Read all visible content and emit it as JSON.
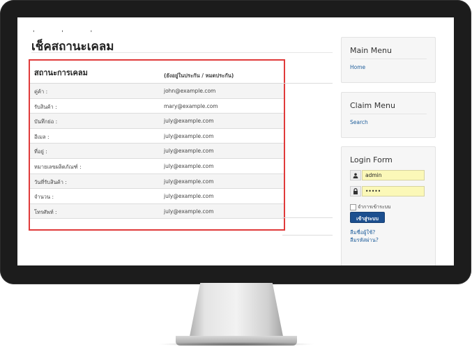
{
  "page": {
    "title": "เช็คสถานะเคลม",
    "top_fragment": "' ' '"
  },
  "claim_table": {
    "heading": "สถานะการเคลม",
    "column_header": "(ยังอยู่ในประกัน / หมดประกัน)",
    "rows": [
      {
        "label": "คู่ค้า :",
        "value": "john@example.com"
      },
      {
        "label": "รับสินค้า :",
        "value": "mary@example.com"
      },
      {
        "label": "บันทึกย่อ :",
        "value": "july@example.com"
      },
      {
        "label": "อีเมล :",
        "value": "july@example.com"
      },
      {
        "label": "ที่อยู่ :",
        "value": "july@example.com"
      },
      {
        "label": "หมายเลขผลิตภัณฑ์ :",
        "value": "july@example.com"
      },
      {
        "label": "วันที่รับสินค้า :",
        "value": "july@example.com"
      },
      {
        "label": "จำนวน :",
        "value": "july@example.com"
      },
      {
        "label": "โทรศัพท์ :",
        "value": "july@example.com"
      }
    ]
  },
  "sidebar": {
    "main_menu": {
      "title": "Main Menu",
      "links": [
        "Home"
      ]
    },
    "claim_menu": {
      "title": "Claim Menu",
      "links": [
        "Search"
      ]
    },
    "login": {
      "title": "Login Form",
      "username_value": "admin",
      "password_value": "•••••",
      "remember_label": "จำการเข้าระบบ",
      "button_label": "เข้าสู่ระบบ",
      "forgot_username": "ลืมชื่อผู้ใช้?",
      "forgot_password": "ลืมรหัสผ่าน?"
    }
  },
  "colors": {
    "highlight_border": "#e03a3a",
    "link": "#1f5e9b",
    "button": "#1c4f8f",
    "input_fill": "#fbf8b8",
    "bezel": "#1c1c1c"
  },
  "icons": [
    "user-icon",
    "lock-icon"
  ]
}
